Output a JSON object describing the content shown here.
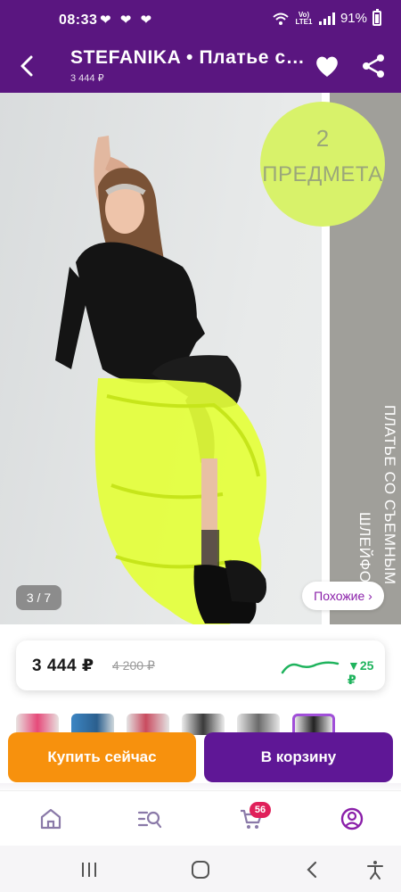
{
  "status_bar": {
    "time": "08:33",
    "notifications": "❤ ❤ ❤",
    "network": "Vo) LTE1",
    "battery": "91%"
  },
  "header": {
    "title": "STEFANIKA • Платье с ...",
    "subtitle": "3 444 ₽"
  },
  "photo": {
    "promo_count": "2",
    "promo_label": "ПРЕДМЕТА",
    "side_caption_line1": "ПЛАТЬЕ СО СЪЕМНЫМ",
    "side_caption_line2": "ШЛЕЙФОМ",
    "counter": "3 / 7",
    "similar_button": "Похожие ›"
  },
  "price": {
    "current": "3 444 ₽",
    "old": "4 200 ₽",
    "change": "▼25 ₽",
    "trend_color": "#1fb35d"
  },
  "thumbnails": {
    "count": 6,
    "active_index": 5
  },
  "actions": {
    "buy_now": "Купить сейчас",
    "to_cart": "В корзину",
    "buy_color": "#f7910d",
    "cart_color": "#5f1796"
  },
  "bottom_nav": {
    "items": [
      "home-icon",
      "catalog-search-icon",
      "cart-icon",
      "profile-icon"
    ],
    "cart_badge": "56",
    "active": "profile-icon"
  },
  "colors": {
    "brand": "#5a1680",
    "accent": "#a04fd8",
    "promo": "#d8f26a"
  }
}
